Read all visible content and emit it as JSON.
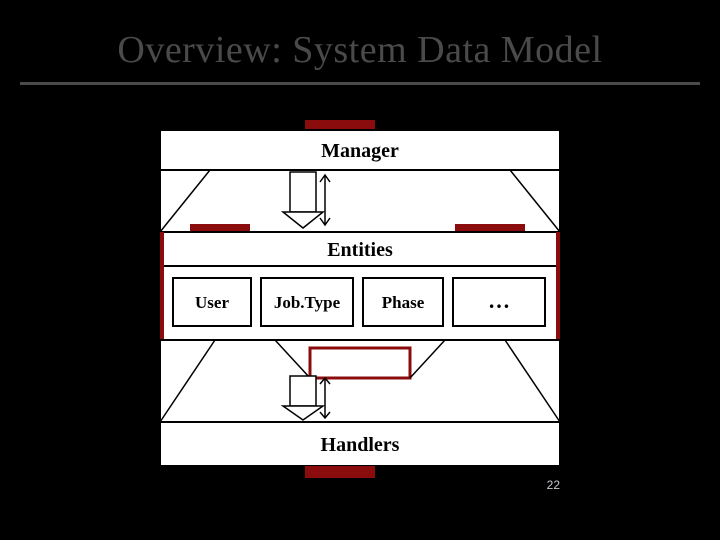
{
  "title": "Overview: System Data Model",
  "page_number": "22",
  "diagram": {
    "manager": {
      "label": "Manager"
    },
    "entities": {
      "label": "Entities"
    },
    "entity_boxes": [
      "User",
      "Job.Type",
      "Phase",
      "…"
    ],
    "handlers": {
      "label": "Handlers"
    }
  }
}
